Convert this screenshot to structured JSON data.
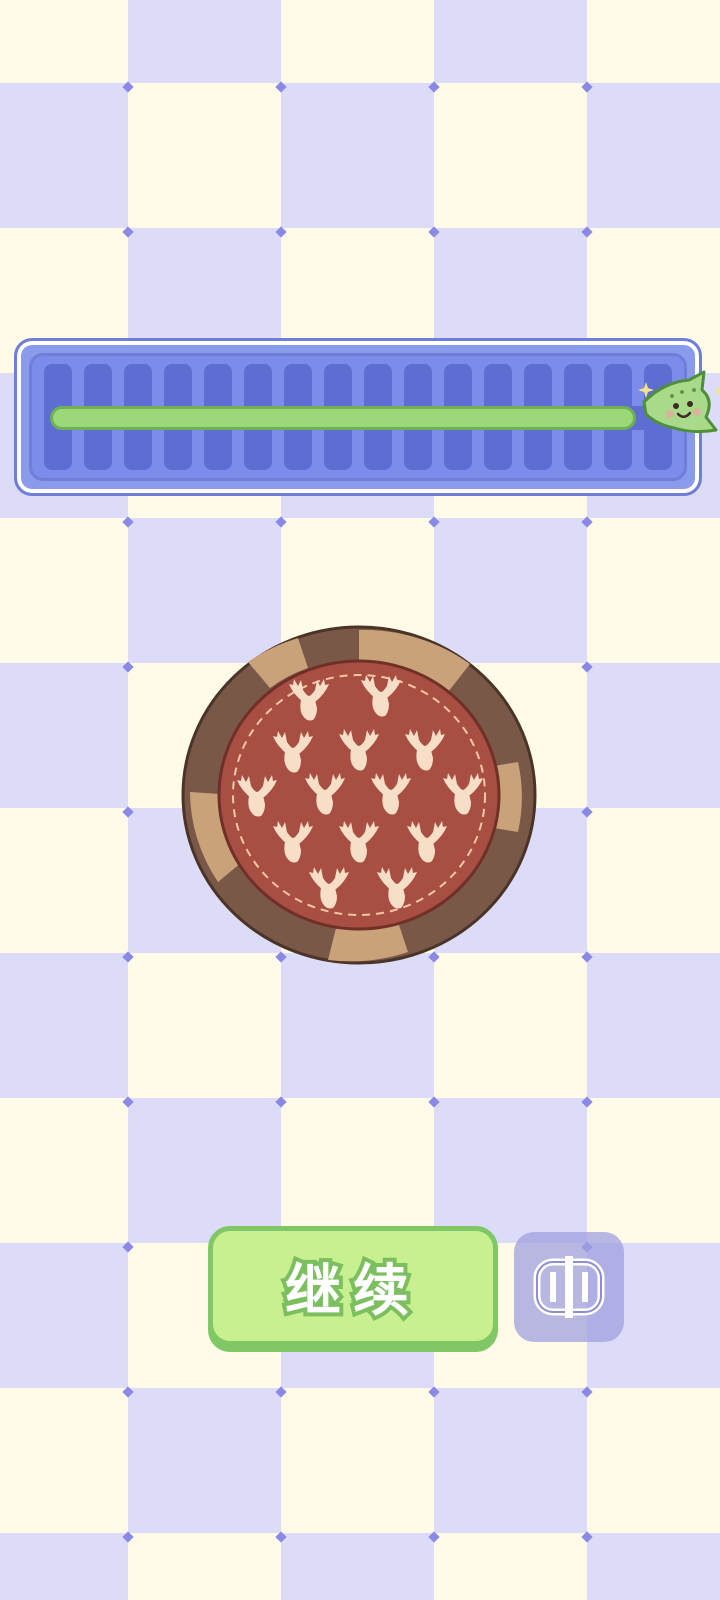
{
  "game": {
    "progress": 0.97,
    "segment_count": 16
  },
  "buttons": {
    "continue_label": "继续"
  },
  "icons": {
    "mascot": "smiling-green-leaf-mascot-icon",
    "share": "share-frame-icon",
    "pie_decoration": "moose-silhouette-icon"
  },
  "colors": {
    "board_light": "#fffbe8",
    "board_dark": "#dcdcf8",
    "progress_panel": "#8b9bec",
    "progress_fill": "#9cd77a",
    "pie_filling": "#a84e43",
    "pie_crust_dark": "#7a5848",
    "pie_crust_light": "#c9a27a",
    "button_green": "#c8ef90"
  }
}
